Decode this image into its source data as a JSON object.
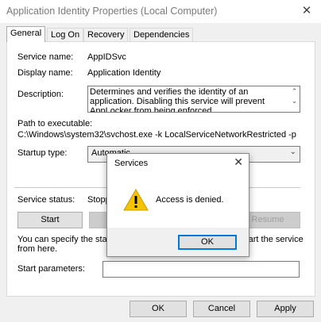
{
  "window": {
    "title": "Application Identity Properties (Local Computer)",
    "close_glyph": "✕"
  },
  "tabs": [
    {
      "label": "General",
      "active": true
    },
    {
      "label": "Log On",
      "active": false
    },
    {
      "label": "Recovery",
      "active": false
    },
    {
      "label": "Dependencies",
      "active": false
    }
  ],
  "general": {
    "service_name_label": "Service name:",
    "service_name": "AppIDSvc",
    "display_name_label": "Display name:",
    "display_name": "Application Identity",
    "description_label": "Description:",
    "description": "Determines and verifies the identity of an application. Disabling this service will prevent AppLocker from being enforced.",
    "path_label": "Path to executable:",
    "path": "C:\\Windows\\system32\\svchost.exe -k LocalServiceNetworkRestricted -p",
    "startup_type_label": "Startup type:",
    "startup_type_value": "Automatic",
    "service_status_label": "Service status:",
    "service_status_value": "Stopped",
    "start_button": "Start",
    "resume_button": "Resume",
    "hint_text_left": "You can specify the start parameters that apply when you start the service",
    "hint_text_line2": "from here.",
    "hint_right": "the service",
    "start_params_label": "Start parameters:",
    "start_params_value": ""
  },
  "footer": {
    "ok": "OK",
    "cancel": "Cancel",
    "apply": "Apply"
  },
  "dialog": {
    "title": "Services",
    "close_glyph": "✕",
    "message": "Access is denied.",
    "ok": "OK",
    "icon": "warning-icon"
  },
  "colors": {
    "accent": "#0078d7",
    "warning": "#f5c400"
  }
}
